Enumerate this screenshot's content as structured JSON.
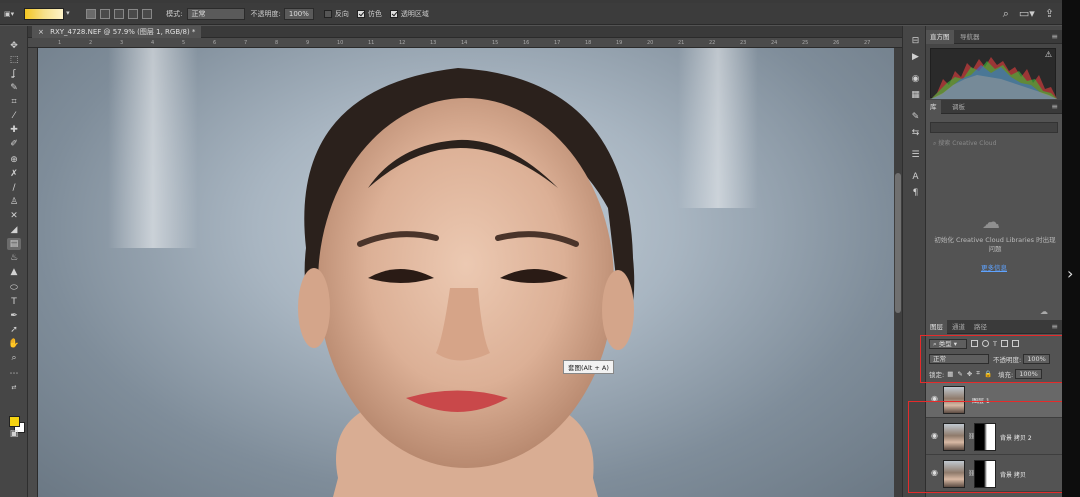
{
  "window": {
    "options_bar": {
      "mode_label": "模式:",
      "mode_value": "正常",
      "opacity_label": "不透明度:",
      "opacity_value": "100%",
      "reverse_label": "反向",
      "dither_label": "仿色",
      "transparency_label": "透明区域"
    },
    "document_tab": "RXY_4728.NEF @ 57.9% (图层 1, RGB/8) *",
    "ruler_ticks": [
      "1",
      "2",
      "3",
      "4",
      "5",
      "6",
      "7",
      "8",
      "9",
      "10",
      "11",
      "12",
      "13",
      "14",
      "15",
      "16",
      "17",
      "18",
      "19",
      "20",
      "21",
      "22",
      "23",
      "24",
      "25",
      "26",
      "27"
    ]
  },
  "canvas": {
    "tooltip": "套图(Alt + A)"
  },
  "panels": {
    "histogram": {
      "tabs": [
        "直方图",
        "导航器"
      ],
      "warning_icon": "warning-icon"
    },
    "libraries": {
      "tabs": [
        "库",
        "调板"
      ],
      "search_placeholder": "搜索 Creative Cloud",
      "message": "初始化 Creative Cloud Libraries 时出现问题",
      "link": "更多信息"
    },
    "layers": {
      "tabs": [
        "图层",
        "通道",
        "路径"
      ],
      "filter_label": "类型",
      "blend_mode": "正常",
      "opacity_label": "不透明度:",
      "opacity_value": "100%",
      "lock_label": "锁定:",
      "fill_label": "填充:",
      "fill_value": "100%",
      "items": [
        {
          "name": "图层 1",
          "selected": true,
          "has_mask": false
        },
        {
          "name": "背景 拷贝 2",
          "selected": false,
          "has_mask": true
        },
        {
          "name": "背景 拷贝",
          "selected": false,
          "has_mask": true
        }
      ]
    }
  },
  "colors": {
    "foreground": "#f5d312",
    "background": "#ffffff",
    "highlight_box": "#e52b2b"
  }
}
